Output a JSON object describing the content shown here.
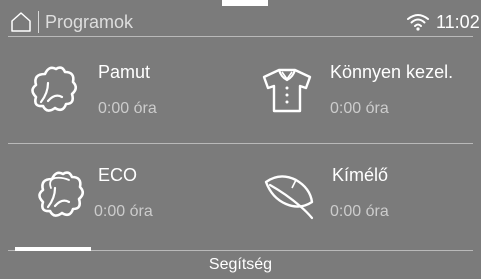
{
  "status_bar": {
    "title": "Programok",
    "time": "11:02",
    "icons": [
      "home-icon",
      "wifi-icon"
    ]
  },
  "programs": [
    {
      "name": "Pamut",
      "duration": "0:00 óra",
      "icon": "cotton-icon"
    },
    {
      "name": "Könnyen kezel.",
      "duration": "0:00 óra",
      "icon": "shirt-icon"
    },
    {
      "name": "ECO",
      "duration": "0:00 óra",
      "icon": "eco-cotton-icon"
    },
    {
      "name": "Kímélő",
      "duration": "0:00 óra",
      "icon": "feather-icon"
    }
  ],
  "footer": {
    "help_label": "Segítség"
  },
  "colors": {
    "background": "#7b7b7b",
    "text": "#ffffff",
    "divider": "#b9b9b9"
  }
}
